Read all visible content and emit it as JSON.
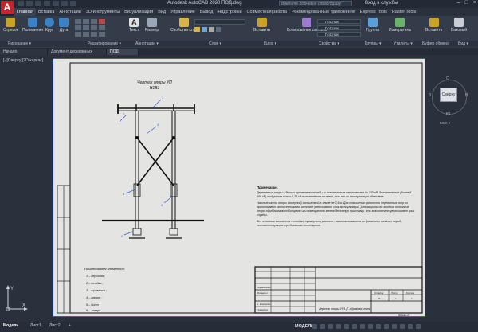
{
  "titlebar": {
    "logo": "A",
    "title": "Autodesk AutoCAD 2020    ПОД.dwg",
    "search_placeholder": "Введите ключевое слово/фразу",
    "signin": "Вход в службы",
    "controls": [
      "–",
      "□",
      "×"
    ]
  },
  "menu": [
    "Главная",
    "Вставка",
    "Аннотации",
    "3D-инструменты",
    "Визуализация",
    "Вид",
    "Управление",
    "Вывод",
    "Надстройки",
    "Совместная работа",
    "Рекомендованные приложения",
    "Express Tools",
    "Raster Tools"
  ],
  "ribbon": {
    "buttons": [
      {
        "label": "Отрезок",
        "color": "#c9a227"
      },
      {
        "label": "Полилиния",
        "color": "#3b82c4"
      },
      {
        "label": "Круг",
        "color": "#3b82c4"
      },
      {
        "label": "Дуга",
        "color": "#3b82c4"
      },
      {
        "label": "Текст",
        "color": "#e0e0e0"
      },
      {
        "label": "Размер",
        "color": "#e0e0e0"
      },
      {
        "label": "Свойства слоя",
        "color": "#d8b34a"
      },
      {
        "label": "Вставить",
        "color": "#c9a227"
      },
      {
        "label": "Копирование свойств",
        "color": "#9a7bd0"
      },
      {
        "label": "Группа",
        "color": "#5aa0d8"
      },
      {
        "label": "Измеритель",
        "color": "#6bb36b"
      },
      {
        "label": "Вставить",
        "color": "#c9a227"
      },
      {
        "label": "Базовый",
        "color": "#c8cdd4"
      }
    ],
    "panels": [
      "Рисование ▾",
      "Редактирование ▾",
      "Аннотации ▾",
      "Слои ▾",
      "Блок ▾",
      "Свойства ▾",
      "Группы ▾",
      "Утилиты ▾",
      "Буфер обмена",
      "Вид ▾"
    ],
    "properties": [
      "ПоСлою",
      "ПоСлою",
      "ПоСлою"
    ]
  },
  "tabs": [
    "Начало",
    "Документ деревянных опор*",
    "ПОД"
  ],
  "viewport": {
    "label": "[-][Сверху][2D-каркас]",
    "viewcube": {
      "face": "Сверху",
      "top": "С",
      "bottom": "Ю",
      "left": "З",
      "right": "В",
      "wcs": "МСК ▾"
    }
  },
  "drawing": {
    "title_line1": "Чертеж опоры УП",
    "title_line2": "Н1В1",
    "callouts": [
      "1",
      "2",
      "3",
      "4",
      "5",
      "6"
    ],
    "notes_heading": "Примечание.",
    "notes_paragraph1": "Деревянные опоры в России применяются на 0,4 с номинальным напряжением до 220 кВ. Значительные (более 6 000 кВ) воздушные линии 0,38 кВ выполняются на сваях, так как их эксплуатация облегчена.",
    "notes_paragraph2": "Наличие части опоры (анкерной) оснащенной в земле не 2,5 м. Для повышения прочности деревянных опор их пропитывают антисептиками, которые увеличивают срок эксплуатации. Для защиты от гниения основание опоры обрабатывают битумом или помещают в железобетонную приставку, что значительно увеличивает срок службы.",
    "notes_paragraph3": "Все основные элементы – стойки, траверсы и раскосы – изготавливаются из древесины хвойных пород, соответствующих требованиям стандартов.",
    "legend_heading": "Наименования элементов:",
    "legend_items": [
      "1 – вершина ;",
      "2 – стойка ;",
      "3 – траверса ;",
      "4 – раскос ;",
      "5 – болт ;",
      "6 – анкер ."
    ],
    "titleblock_text": "Чертеж опоры УП1 (Г-образная) поля",
    "titleblock_stamp_headers": [
      "Стадия",
      "Лист",
      "Листов"
    ],
    "titleblock_stamp_values": [
      "П",
      "1",
      "1"
    ],
    "titleblock_rows": [
      "Разработал",
      "Проверил",
      "Н. контроль",
      "Утвердил"
    ],
    "titleblock_small": "Формат А3"
  },
  "status": {
    "tabs": [
      "Модель",
      "Лист1",
      "Лист2",
      "+"
    ],
    "mode": "МОДЕЛЬ"
  },
  "axis": {
    "x": "X",
    "y": "Y"
  }
}
